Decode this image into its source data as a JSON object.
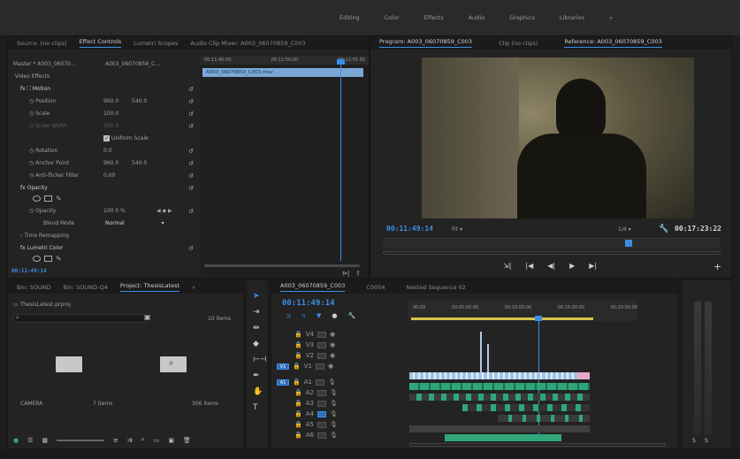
{
  "workspace_tabs": [
    "Editing",
    "Color",
    "Effects",
    "Audio",
    "Graphics",
    "Libraries"
  ],
  "top_left_panel": {
    "tabs": [
      "Source: (no clips)",
      "Effect Controls",
      "Lumetri Scopes",
      "Audio Clip Mixer: A003_06070859_C003"
    ],
    "master_label": "Master * A003_06070...",
    "sequence_label": "A003_06070859_C...",
    "video_effects_label": "Video Effects",
    "motion": {
      "label": "Motion",
      "position_label": "Position",
      "position_x": "960.0",
      "position_y": "540.0",
      "scale_label": "Scale",
      "scale_value": "100.0",
      "scale_width_label": "Scale Width",
      "scale_width_value": "100.0",
      "uniform_scale_label": "Uniform Scale",
      "rotation_label": "Rotation",
      "rotation_value": "0.0",
      "anchor_label": "Anchor Point",
      "anchor_x": "960.0",
      "anchor_y": "540.0",
      "antiflicker_label": "Anti-flicker Filter",
      "antiflicker_value": "0.00"
    },
    "opacity": {
      "label": "Opacity",
      "opacity_label": "Opacity",
      "opacity_value": "100.0 %",
      "blend_label": "Blend Mode",
      "blend_value": "Normal"
    },
    "time_remap_label": "Time Remapping",
    "lumetri_label": "Lumetri Color",
    "timecode": "00:11:49:14",
    "ruler_start": "00:11:45:00",
    "ruler_mid": "00:11:50:00",
    "ruler_end": "00:11:55:00",
    "clip_name": "A003_06070859_C003.mov"
  },
  "program_monitor": {
    "tabs": [
      "Program: A003_06070859_C003",
      "Clip (no clips)",
      "Reference: A003_06070859_C003"
    ],
    "timecode": "00:11:49:14",
    "fit_label": "Fit",
    "resolution": "1/4",
    "duration": "00:17:23:22"
  },
  "project_panel": {
    "tabs": [
      "Bin: SOUND",
      "Bin: SOUND-Q4",
      "Project: ThesisLatest"
    ],
    "project_file": "ThesisLatest.prproj",
    "item_count": "10 items",
    "bin_label": "CAMERA",
    "bin_items": "7 items",
    "bin_duration": "306 items"
  },
  "timeline": {
    "tabs": [
      "A003_06070859_C003",
      "C0004",
      "Nested Sequence 02"
    ],
    "timecode": "00:11:49:14",
    "ruler": [
      "00:00",
      "00:05:00:00",
      "00:10:00:00",
      "00:15:00:00",
      "00:20:00:00"
    ],
    "video_tracks": [
      "V4",
      "V3",
      "V2",
      "V1"
    ],
    "audio_tracks": [
      "A1",
      "A2",
      "A3",
      "A4",
      "A5",
      "A6"
    ],
    "source_labels": [
      "V1",
      "A1"
    ]
  },
  "colors": {
    "accent": "#3a8ee6",
    "panel": "#232323",
    "dark": "#1b1b1b"
  }
}
